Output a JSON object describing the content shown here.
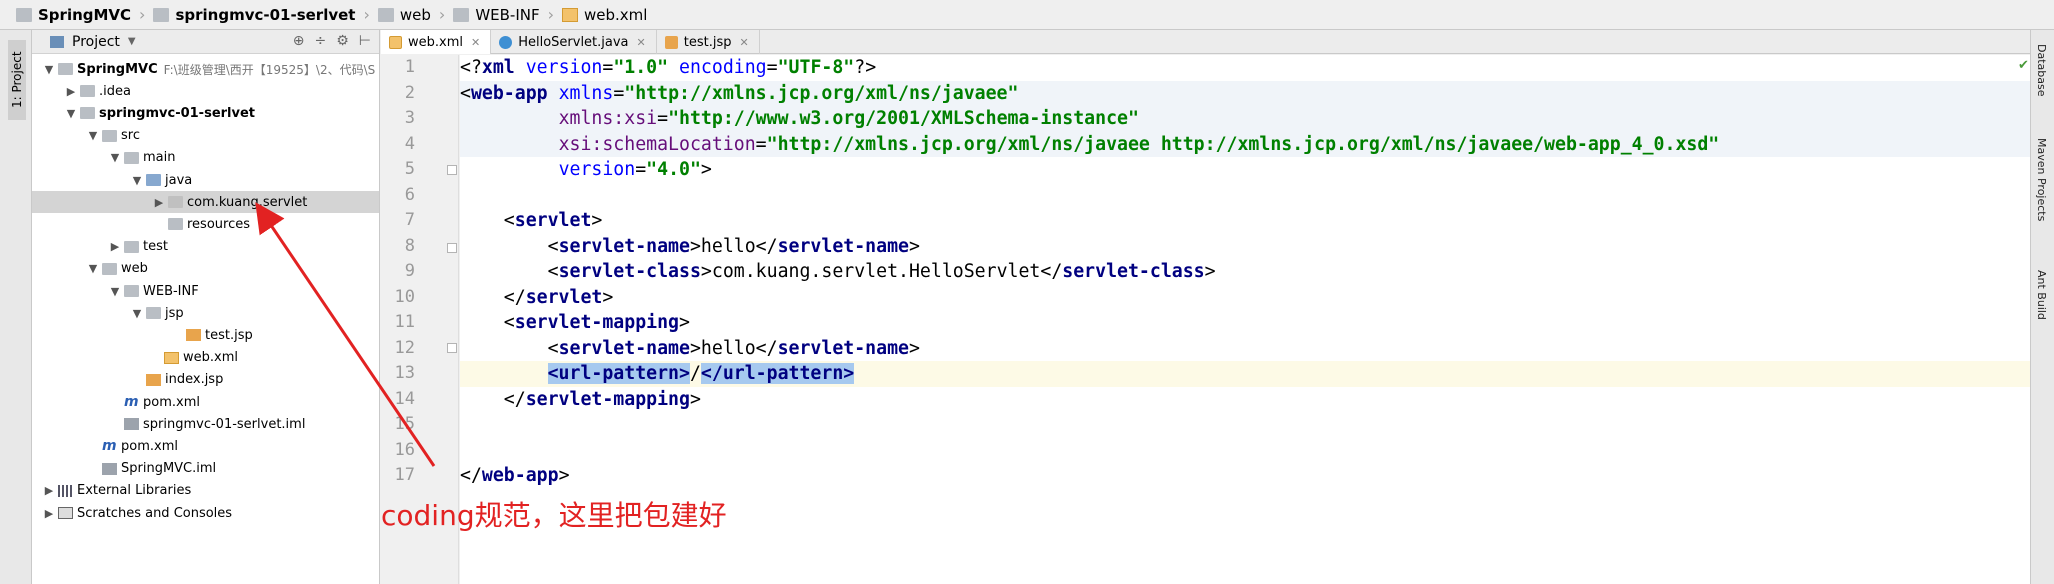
{
  "breadcrumb": [
    "SpringMVC",
    "springmvc-01-serlvet",
    "web",
    "WEB-INF",
    "web.xml"
  ],
  "left_strip": {
    "project_tab": "1: Project"
  },
  "project_panel": {
    "header_label": "Project",
    "tree": [
      {
        "label": "SpringMVC",
        "path": "F:\\班级管理\\西开【19525】\\2、代码\\S",
        "arrow": "▼",
        "icon": "folder",
        "bold": true
      },
      {
        "label": ".idea",
        "arrow": "▶",
        "icon": "folder"
      },
      {
        "label": "springmvc-01-serlvet",
        "arrow": "▼",
        "icon": "folder",
        "bold": true
      },
      {
        "label": "src",
        "arrow": "▼",
        "icon": "folder"
      },
      {
        "label": "main",
        "arrow": "▼",
        "icon": "folder"
      },
      {
        "label": "java",
        "arrow": "▼",
        "icon": "folder-src"
      },
      {
        "label": "com.kuang.servlet",
        "arrow": "▶",
        "icon": "folder-pkg",
        "selected": true
      },
      {
        "label": "resources",
        "arrow": "",
        "icon": "folder"
      },
      {
        "label": "test",
        "arrow": "▶",
        "icon": "folder"
      },
      {
        "label": "web",
        "arrow": "▼",
        "icon": "folder"
      },
      {
        "label": "WEB-INF",
        "arrow": "▼",
        "icon": "folder"
      },
      {
        "label": "jsp",
        "arrow": "▼",
        "icon": "folder"
      },
      {
        "label": "test.jsp",
        "arrow": "",
        "icon": "jsp"
      },
      {
        "label": "web.xml",
        "arrow": "",
        "icon": "xml"
      },
      {
        "label": "index.jsp",
        "arrow": "",
        "icon": "jsp"
      },
      {
        "label": "pom.xml",
        "arrow": "",
        "icon": "maven"
      },
      {
        "label": "springmvc-01-serlvet.iml",
        "arrow": "",
        "icon": "iml"
      },
      {
        "label": "pom.xml",
        "arrow": "",
        "icon": "maven"
      },
      {
        "label": "SpringMVC.iml",
        "arrow": "",
        "icon": "iml"
      },
      {
        "label": "External Libraries",
        "arrow": "▶",
        "icon": "lib"
      },
      {
        "label": "Scratches and Consoles",
        "arrow": "▶",
        "icon": "scratch"
      }
    ]
  },
  "editor_tabs": [
    {
      "label": "web.xml",
      "active": true
    },
    {
      "label": "HelloServlet.java",
      "active": false
    },
    {
      "label": "test.jsp",
      "active": false
    }
  ],
  "code": {
    "line_numbers": [
      "1",
      "2",
      "3",
      "4",
      "5",
      "6",
      "7",
      "8",
      "9",
      "10",
      "11",
      "12",
      "13",
      "14",
      "15",
      "16",
      "17"
    ]
  },
  "right_strip": [
    "Database",
    "Maven Projects",
    "Ant Build"
  ],
  "annotation": "coding规范，这里把包建好",
  "colors": {
    "annotation": "#e22222",
    "tag": "#000080",
    "attr": "#0000ff",
    "string": "#008000"
  }
}
